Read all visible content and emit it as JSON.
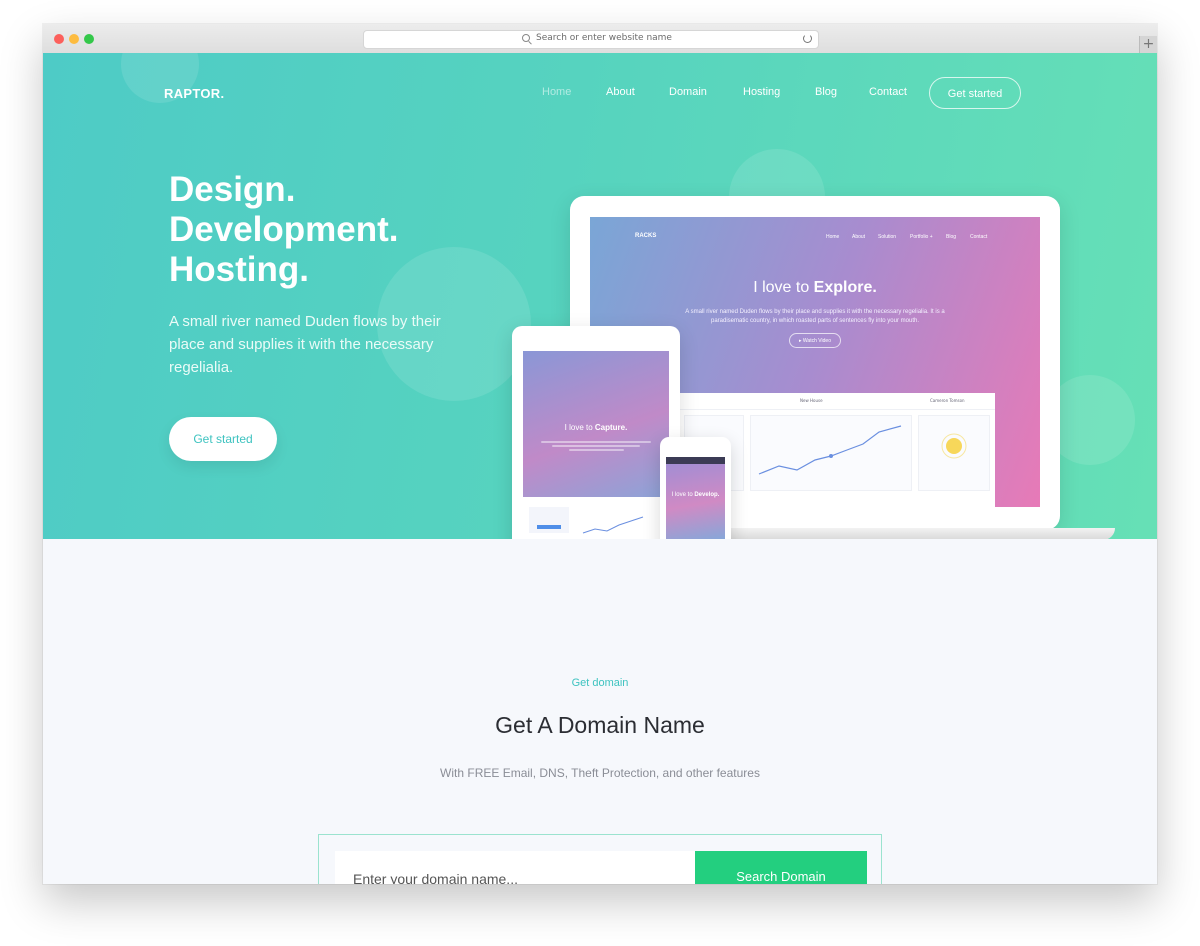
{
  "browser": {
    "address_placeholder": "Search or enter website name",
    "new_tab": "+"
  },
  "brand": "RAPTOR.",
  "nav": {
    "items": [
      "Home",
      "About",
      "Domain",
      "Hosting",
      "Blog",
      "Contact"
    ],
    "active": "Home",
    "cta": "Get started"
  },
  "hero": {
    "headline": [
      "Design.",
      "Development.",
      "Hosting."
    ],
    "subtitle": "A small river named Duden flows by their place and supplies it with the necessary regelialia.",
    "cta": "Get started"
  },
  "mockup_laptop": {
    "brand": "RACKS",
    "nav": [
      "Home",
      "About",
      "Solution",
      "Portfolio +",
      "Blog",
      "Contact"
    ],
    "title_prefix": "I love to ",
    "title_emph": "Explore.",
    "description": "A small river named Duden flows by their place and supplies it with the necessary regelialia. It is a paradisematic country, in which roasted parts of sentences fly into your mouth.",
    "button": "▸ Watch Video",
    "dash_left": "New House",
    "dash_right": "Cameron Tomson"
  },
  "mockup_tablet": {
    "title_prefix": "I love to ",
    "title_emph": "Capture."
  },
  "mockup_phone": {
    "title_prefix": "I love to ",
    "title_emph": "Develop."
  },
  "domain": {
    "eyebrow": "Get domain",
    "title": "Get A Domain Name",
    "subtitle": "With FREE Email, DNS, Theft Protection, and other features",
    "input_placeholder": "Enter your domain name...",
    "button": "Search Domain"
  },
  "colors": {
    "accent": "#3ec3c0",
    "search_button": "#23cf7f",
    "hero_gradient_start": "#4ecbc6",
    "hero_gradient_end": "#66e0b6"
  }
}
